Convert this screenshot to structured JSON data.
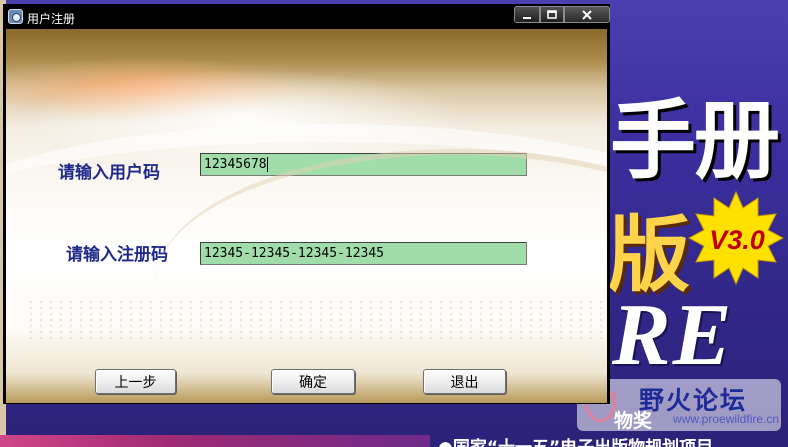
{
  "window": {
    "title": "用户注册",
    "controls": {
      "minimize": "—",
      "maximize": "□",
      "close": "✕"
    }
  },
  "form": {
    "user_code": {
      "label": "请输入用户码",
      "value": "12345678"
    },
    "reg_code": {
      "label": "请输入注册码",
      "value": "12345-12345-12345-12345"
    }
  },
  "buttons": {
    "prev": "上一步",
    "ok": "确定",
    "exit": "退出"
  },
  "background": {
    "title": "手册",
    "edition": "版",
    "version": "V3.0",
    "product": "RE",
    "award": "物奖",
    "bottom_text": "●国家“十一五”电子出版物规划项目"
  },
  "watermark": {
    "name": "野火论坛",
    "url": "www.proewildfire.cn"
  },
  "colors": {
    "field_bg": "#a0ddaa",
    "label": "#1f2a8a",
    "titlebar": "#000000"
  }
}
